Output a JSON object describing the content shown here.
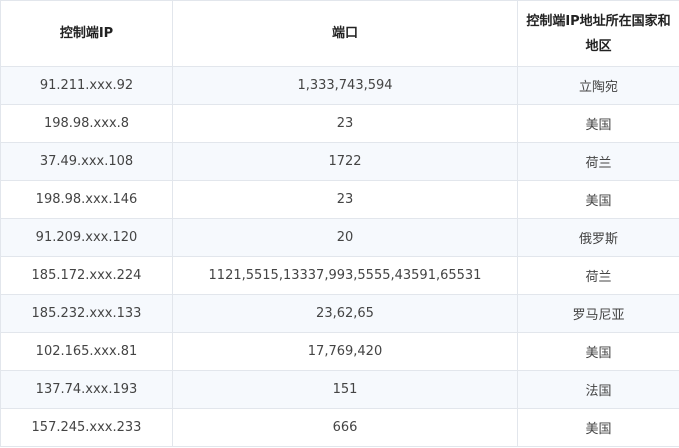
{
  "table": {
    "headers": [
      "控制端IP",
      "端口",
      "控制端IP地址所在国家和地区"
    ],
    "rows": [
      [
        "91.211.xxx.92",
        "1,333,743,594",
        "立陶宛"
      ],
      [
        "198.98.xxx.8",
        "23",
        "美国"
      ],
      [
        "37.49.xxx.108",
        "1722",
        "荷兰"
      ],
      [
        "198.98.xxx.146",
        "23",
        "美国"
      ],
      [
        "91.209.xxx.120",
        "20",
        "俄罗斯"
      ],
      [
        "185.172.xxx.224",
        "1121,5515,13337,993,5555,43591,65531",
        "荷兰"
      ],
      [
        "185.232.xxx.133",
        "23,62,65",
        "罗马尼亚"
      ],
      [
        "102.165.xxx.81",
        "17,769,420",
        "美国"
      ],
      [
        "137.74.xxx.193",
        "151",
        "法国"
      ],
      [
        "157.245.xxx.233",
        "666",
        "美国"
      ]
    ]
  }
}
